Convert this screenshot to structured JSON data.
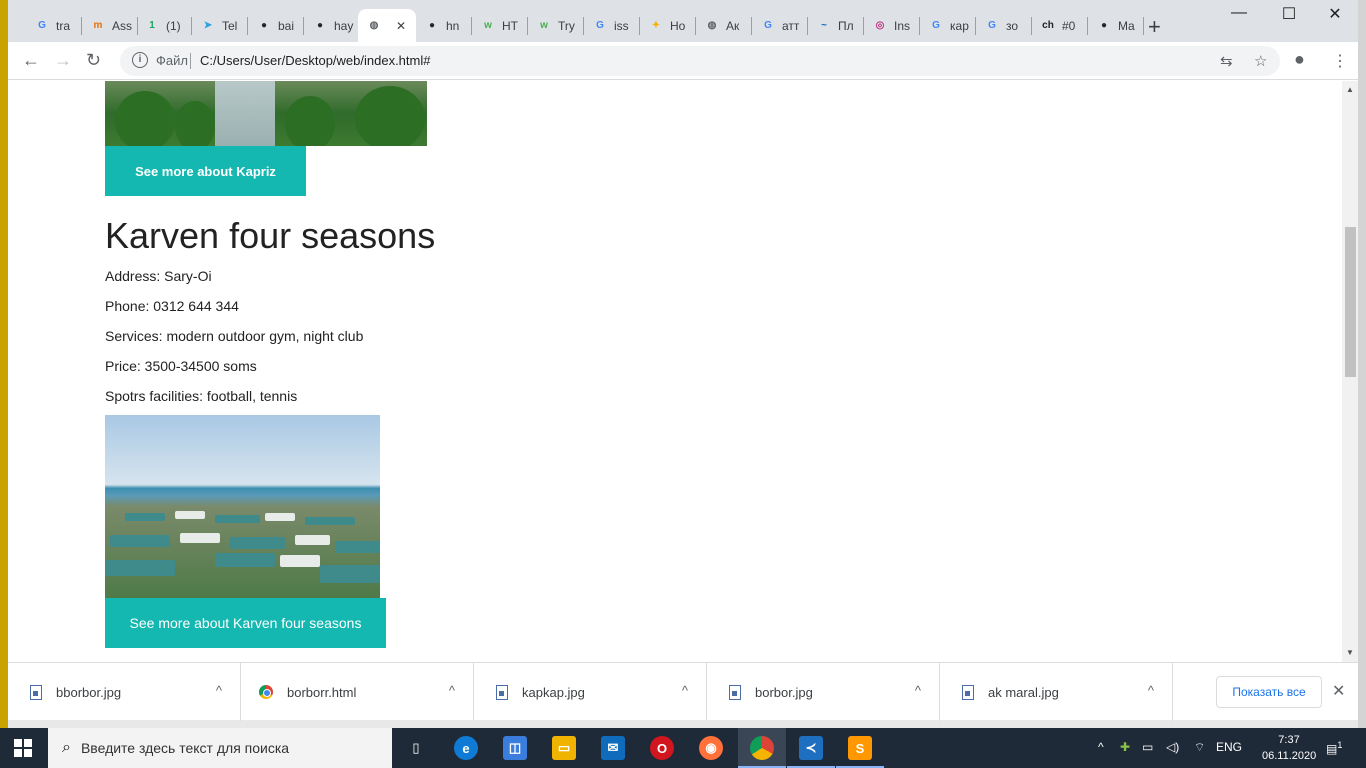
{
  "browser": {
    "tabs": [
      {
        "label": "tra",
        "fav": "G",
        "color": "#4285f4"
      },
      {
        "label": "Ass",
        "fav": "m",
        "color": "#e8710a"
      },
      {
        "label": "(1)",
        "fav": "1",
        "color": "#1ea362"
      },
      {
        "label": "Tel",
        "fav": "➤",
        "color": "#2aa3df"
      },
      {
        "label": "bai",
        "fav": "●",
        "color": "#24292e"
      },
      {
        "label": "hay",
        "fav": "●",
        "color": "#24292e"
      },
      {
        "label": "",
        "fav": "◍",
        "color": "#5f6368"
      },
      {
        "label": "hn",
        "fav": "●",
        "color": "#24292e"
      },
      {
        "label": "HT",
        "fav": "w",
        "color": "#4caf50"
      },
      {
        "label": "Try",
        "fav": "w",
        "color": "#4caf50"
      },
      {
        "label": "iss",
        "fav": "G",
        "color": "#4285f4"
      },
      {
        "label": "Ho",
        "fav": "✦",
        "color": "#f4b400"
      },
      {
        "label": "Ак",
        "fav": "◍",
        "color": "#5f6368"
      },
      {
        "label": "атт",
        "fav": "G",
        "color": "#4285f4"
      },
      {
        "label": "Пл",
        "fav": "~",
        "color": "#1565c0"
      },
      {
        "label": "Ins",
        "fav": "◎",
        "color": "#c13584"
      },
      {
        "label": "кар",
        "fav": "G",
        "color": "#4285f4"
      },
      {
        "label": "зо",
        "fav": "G",
        "color": "#4285f4"
      },
      {
        "label": "#0",
        "fav": "ch",
        "color": "#222222"
      },
      {
        "label": "Ma",
        "fav": "●",
        "color": "#24292e"
      }
    ],
    "active_tab_index": 6,
    "close_glyph": "✕",
    "new_tab_glyph": "+",
    "address": {
      "file_label": "Файл",
      "url": "C:/Users/User/Desktop/web/index.html#"
    }
  },
  "page": {
    "kapriz_button": "See more about Kapriz",
    "hotel": {
      "title": "Karven four seasons",
      "address": "Address: Sary-Oi",
      "phone": "Phone: 0312 644 344",
      "services": "Services: modern outdoor gym, night club",
      "price": "Price: 3500-34500 soms",
      "sports": "Spotrs facilities: football, tennis",
      "button": "See more about Karven four seasons"
    }
  },
  "downloads": {
    "items": [
      {
        "name": "bborbor.jpg",
        "type": "image"
      },
      {
        "name": "borborr.html",
        "type": "chrome"
      },
      {
        "name": "kapkap.jpg",
        "type": "image"
      },
      {
        "name": "borbor.jpg",
        "type": "image"
      },
      {
        "name": "ak maral.jpg",
        "type": "image"
      }
    ],
    "show_all": "Показать все"
  },
  "taskbar": {
    "search_placeholder": "Введите здесь текст для поиска",
    "language": "ENG",
    "time": "7:37",
    "date": "06.11.2020",
    "notifications": "1"
  },
  "colors": {
    "accent_button": "#14b8b0"
  }
}
